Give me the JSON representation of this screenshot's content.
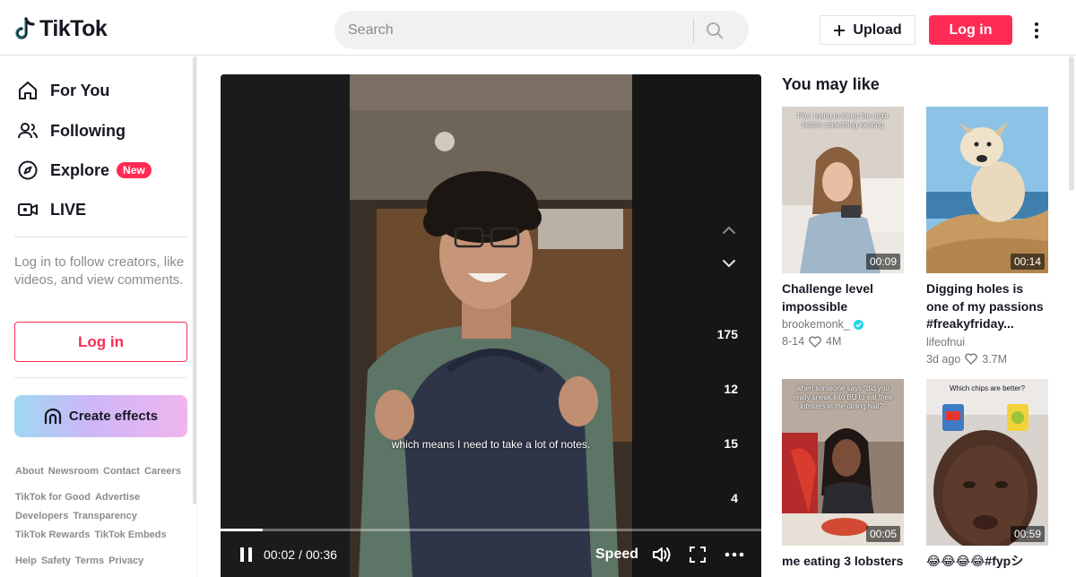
{
  "header": {
    "logo_text": "TikTok",
    "search_placeholder": "Search",
    "upload_label": "Upload",
    "login_label": "Log in"
  },
  "sidebar": {
    "items": [
      {
        "label": "For You",
        "icon": "home-icon"
      },
      {
        "label": "Following",
        "icon": "users-icon"
      },
      {
        "label": "Explore",
        "icon": "compass-icon",
        "badge": "New"
      },
      {
        "label": "LIVE",
        "icon": "live-icon"
      }
    ],
    "login_hint": "Log in to follow creators, like videos, and view comments.",
    "login_button": "Log in",
    "effects_button": "Create effects",
    "footer": [
      [
        "About",
        "Newsroom",
        "Contact",
        "Careers"
      ],
      [
        "TikTok for Good",
        "Advertise"
      ],
      [
        "Developers",
        "Transparency"
      ],
      [
        "TikTok Rewards",
        "TikTok Embeds"
      ],
      [
        "Help",
        "Safety",
        "Terms",
        "Privacy"
      ]
    ]
  },
  "video": {
    "subtitle": "which means I need to take a lot of notes.",
    "counts": [
      "175",
      "12",
      "15",
      "4"
    ],
    "current_time": "00:02",
    "total_time": "00:36",
    "time_separator": "/",
    "progress": 0.078,
    "speed_label": "Speed"
  },
  "recommendations": {
    "title": "You may like",
    "cards": [
      {
        "duration": "00:09",
        "caption": "Pov: trying to sleep the night before something exciting",
        "title": "Challenge level impossible",
        "author": "brookemonk_",
        "verified": true,
        "date": "8-14",
        "likes": "4M"
      },
      {
        "duration": "00:14",
        "caption": "",
        "title": "Digging holes is one of my passions #freakyfriday...",
        "author": "lifeofnui",
        "verified": false,
        "date": "3d ago",
        "likes": "3.7M"
      },
      {
        "duration": "00:05",
        "caption": "when someone says \"did you really sneak into BU to eat their lobsters in the dining hall?\"",
        "title": "me eating 3 lobsters",
        "author": "",
        "verified": false,
        "date": "",
        "likes": ""
      },
      {
        "duration": "00:59",
        "caption": "Which chips are better?",
        "title": "😂😂😂😂#fypシ",
        "author": "",
        "verified": false,
        "date": "",
        "likes": ""
      }
    ]
  },
  "colors": {
    "brand": "#fe2c55",
    "text": "#161823",
    "muted": "#8a8b91"
  }
}
